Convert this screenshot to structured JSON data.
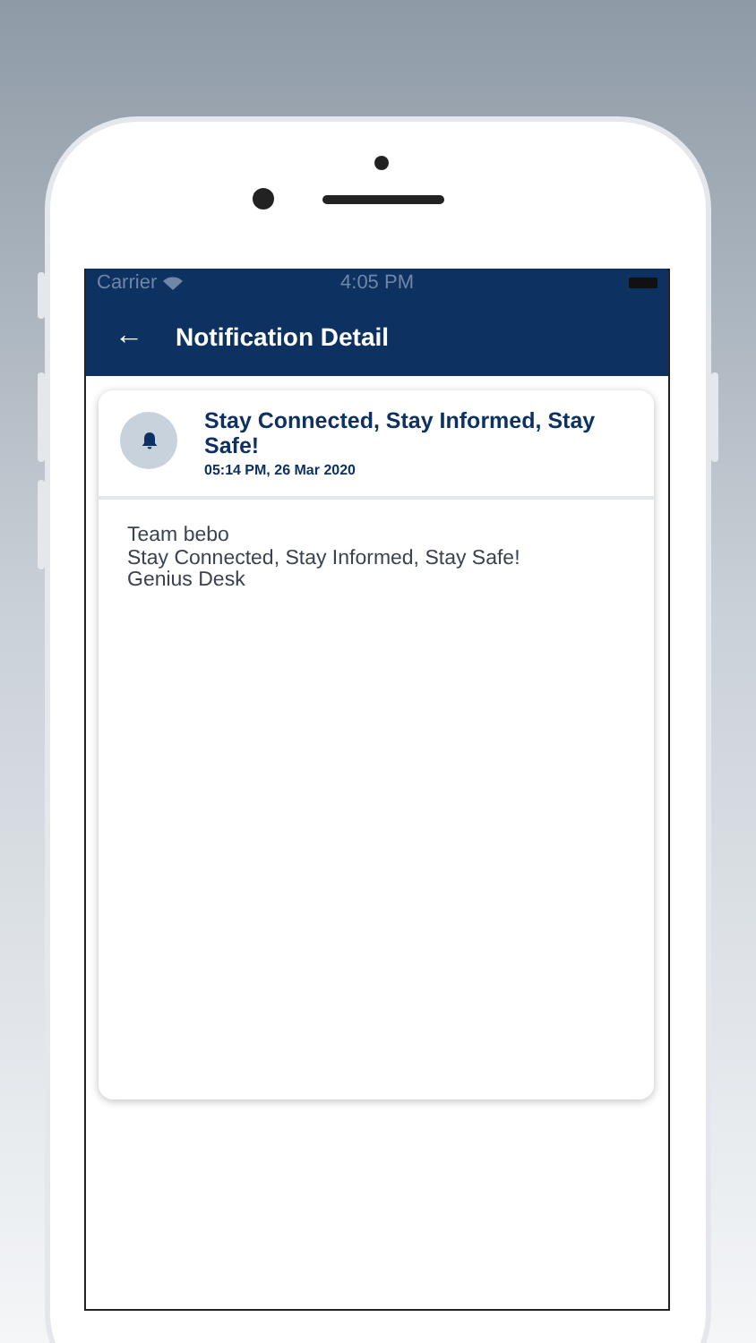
{
  "status_bar": {
    "carrier": "Carrier",
    "time": "4:05 PM"
  },
  "header": {
    "back": "←",
    "title": "Notification Detail"
  },
  "notification": {
    "title": "Stay Connected, Stay Informed, Stay Safe!",
    "timestamp": "05:14 PM, 26 Mar 2020",
    "body": [
      "Team bebo",
      "Stay Connected, Stay Informed, Stay Safe!",
      "Genius Desk"
    ]
  }
}
